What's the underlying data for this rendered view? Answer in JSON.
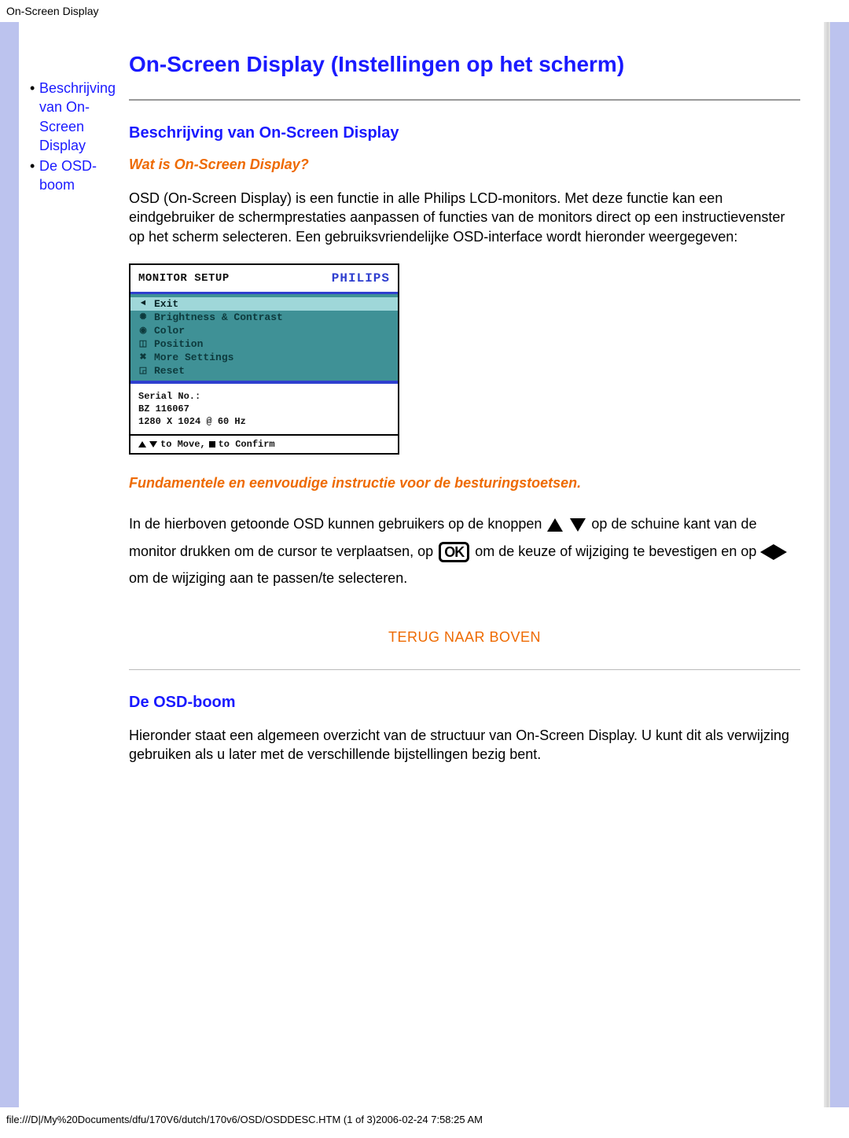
{
  "header": {
    "doc_title": "On-Screen Display"
  },
  "sidebar": {
    "items": [
      {
        "label": "Beschrijving van On-Screen Display"
      },
      {
        "label": "De OSD-boom"
      }
    ]
  },
  "page": {
    "title": "On-Screen Display (Instellingen op het scherm)",
    "section1": {
      "heading": "Beschrijving van On-Screen Display",
      "subheading": "Wat is On-Screen Display?",
      "paragraph": "OSD (On-Screen Display) is een functie in alle Philips LCD-monitors. Met deze functie kan een eindgebruiker de schermprestaties aanpassen of functies van de monitors direct op een instructievenster op het scherm selecteren. Een gebruiksvriendelijke OSD-interface wordt hieronder weergegeven:"
    },
    "osd": {
      "title": "MONITOR SETUP",
      "brand": "PHILIPS",
      "items": [
        {
          "label": "Exit",
          "selected": true,
          "glyph": "◄"
        },
        {
          "label": "Brightness & Contrast",
          "selected": false,
          "glyph": "✺"
        },
        {
          "label": "Color",
          "selected": false,
          "glyph": "◉"
        },
        {
          "label": "Position",
          "selected": false,
          "glyph": "◫"
        },
        {
          "label": "More Settings",
          "selected": false,
          "glyph": "✖"
        },
        {
          "label": "Reset",
          "selected": false,
          "glyph": "◲"
        }
      ],
      "serial_label": "Serial No.:",
      "serial_value": "BZ 116067",
      "mode": "1280 X 1024 @ 60 Hz",
      "footer_move": "to Move,",
      "footer_confirm": "to Confirm"
    },
    "subnote": "Fundamentele en eenvoudige instructie voor de besturingstoetsen.",
    "para2": {
      "p1": "In de hierboven getoonde OSD kunnen gebruikers op de knoppen ",
      "p2": " op de schuine kant van de monitor drukken om de cursor te verplaatsen, op ",
      "p3": " om de keuze of wijziging te bevestigen en op ",
      "p4": " om de wijziging aan te passen/te selecteren.",
      "ok": "OK"
    },
    "back_to_top": "TERUG NAAR BOVEN",
    "section2": {
      "heading": "De OSD-boom",
      "paragraph": "Hieronder staat een algemeen overzicht van de structuur van On-Screen Display. U kunt dit als verwijzing gebruiken als u later met de verschillende bijstellingen bezig bent."
    }
  },
  "footer": {
    "path": "file:///D|/My%20Documents/dfu/170V6/dutch/170v6/OSD/OSDDESC.HTM (1 of 3)2006-02-24 7:58:25 AM"
  }
}
